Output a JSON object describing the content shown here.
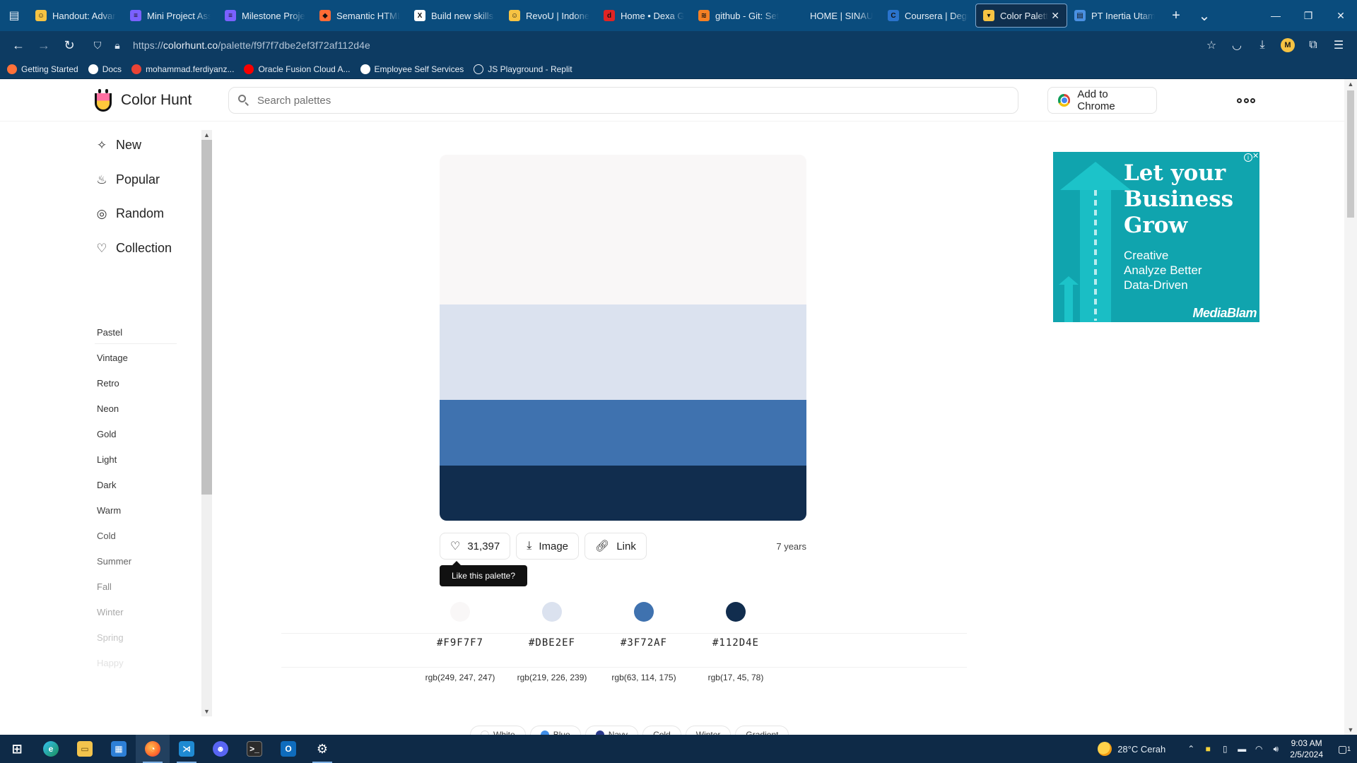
{
  "browser": {
    "tabs": [
      {
        "label": "Handout: Advanc",
        "favicon": "revou-icon",
        "color": "#f6c343",
        "glyph": "☺"
      },
      {
        "label": "Mini Project Assi",
        "favicon": "list-icon",
        "color": "#7b61ff",
        "glyph": "≡"
      },
      {
        "label": "Milestone Project",
        "favicon": "list-icon",
        "color": "#7b61ff",
        "glyph": "≡"
      },
      {
        "label": "Semantic HTML:",
        "favicon": "dev-icon",
        "color": "#ff6b35",
        "glyph": "◆"
      },
      {
        "label": "Build new skills. A",
        "favicon": "x-icon",
        "color": "#ffffff",
        "glyph": "X"
      },
      {
        "label": "RevoU | Indonesia",
        "favicon": "revou-icon",
        "color": "#f6c343",
        "glyph": "☺"
      },
      {
        "label": "Home • Dexa Gro",
        "favicon": "dexa-icon",
        "color": "#e02424",
        "glyph": "d"
      },
      {
        "label": "github - Git: Set I",
        "favicon": "stackoverflow-icon",
        "color": "#f48024",
        "glyph": "≋"
      },
      {
        "label": "HOME | SINAU",
        "favicon": "blank-icon",
        "color": "transparent",
        "glyph": ""
      },
      {
        "label": "Coursera | Degree",
        "favicon": "coursera-icon",
        "color": "#2a73cc",
        "glyph": "C"
      },
      {
        "label": "Color Palette: #",
        "favicon": "colorhunt-icon",
        "color": "#f6c343",
        "glyph": "▾",
        "active": true
      },
      {
        "label": "PT Inertia Utama",
        "favicon": "doc-icon",
        "color": "#4a90e2",
        "glyph": "▤"
      }
    ],
    "url_prefix": "https://",
    "url_host": "colorhunt.co",
    "url_path": "/palette/f9f7f7dbe2ef3f72af112d4e",
    "profile_initial": "M",
    "bookmarks": [
      {
        "label": "Getting Started",
        "icon": "firefox-icon",
        "color": "#ff7139"
      },
      {
        "label": "Docs",
        "icon": "notion-icon",
        "color": "#ffffff"
      },
      {
        "label": "mohammad.ferdiyanz...",
        "icon": "gmail-icon",
        "color": "#ea4335"
      },
      {
        "label": "Oracle Fusion Cloud A...",
        "icon": "oracle-icon",
        "color": "#f80000"
      },
      {
        "label": "Employee Self Services",
        "icon": "ess-icon",
        "color": "#ffffff"
      },
      {
        "label": "JS Playground - Replit",
        "icon": "globe-icon",
        "color": "transparent"
      }
    ]
  },
  "site": {
    "logo_text": "Color Hunt",
    "search_placeholder": "Search palettes",
    "add_chrome_label": "Add to Chrome"
  },
  "sidebar": {
    "nav": [
      {
        "label": "New",
        "icon": "sparkle-icon",
        "glyph": "✧"
      },
      {
        "label": "Popular",
        "icon": "fire-icon",
        "glyph": "♨"
      },
      {
        "label": "Random",
        "icon": "random-icon",
        "glyph": "◎"
      },
      {
        "label": "Collection",
        "icon": "heart-icon",
        "glyph": "♡"
      }
    ],
    "tags": [
      {
        "label": "Pastel",
        "color": "#333333"
      },
      {
        "label": "Vintage",
        "color": "#333333"
      },
      {
        "label": "Retro",
        "color": "#333333"
      },
      {
        "label": "Neon",
        "color": "#333333"
      },
      {
        "label": "Gold",
        "color": "#333333"
      },
      {
        "label": "Light",
        "color": "#333333"
      },
      {
        "label": "Dark",
        "color": "#333333"
      },
      {
        "label": "Warm",
        "color": "#3a3a3a"
      },
      {
        "label": "Cold",
        "color": "#555555"
      },
      {
        "label": "Summer",
        "color": "#666666"
      },
      {
        "label": "Fall",
        "color": "#8a8a8a"
      },
      {
        "label": "Winter",
        "color": "#a8a8a8"
      },
      {
        "label": "Spring",
        "color": "#c4c4c4"
      },
      {
        "label": "Happy",
        "color": "#e2e2e2"
      }
    ]
  },
  "palette": {
    "swatches": [
      {
        "color": "#f9f7f7",
        "share": 0.41
      },
      {
        "color": "#dbe2ef",
        "share": 0.26
      },
      {
        "color": "#3f72af",
        "share": 0.18
      },
      {
        "color": "#112d4e",
        "share": 0.15
      }
    ],
    "likes": "31,397",
    "image_label": "Image",
    "link_label": "Link",
    "age": "7 years",
    "tooltip": "Like this palette?",
    "colors": [
      {
        "hex": "#F9F7F7",
        "rgb": "rgb(249, 247, 247)",
        "color": "#f9f7f7"
      },
      {
        "hex": "#DBE2EF",
        "rgb": "rgb(219, 226, 239)",
        "color": "#dbe2ef"
      },
      {
        "hex": "#3F72AF",
        "rgb": "rgb(63, 114, 175)",
        "color": "#3f72af"
      },
      {
        "hex": "#112D4E",
        "rgb": "rgb(17, 45, 78)",
        "color": "#112d4e"
      }
    ],
    "chips": [
      {
        "label": "White",
        "color": "#ffffff"
      },
      {
        "label": "Blue",
        "color": "#3f8ee8"
      },
      {
        "label": "Navy",
        "color": "#2b3a8c"
      },
      {
        "label": "Cold",
        "color": ""
      },
      {
        "label": "Winter",
        "color": ""
      },
      {
        "label": "Gradient",
        "color": ""
      }
    ]
  },
  "ad": {
    "headline": "Let your Business Grow",
    "lines": [
      "Creative",
      "Analyze Better",
      "Data-Driven"
    ],
    "brand": "MediaBlam",
    "bg_color": "#10a4ae"
  },
  "taskbar": {
    "weather": "28°C  Cerah",
    "time": "9:03 AM",
    "date": "2/5/2024",
    "notification_count": "1"
  }
}
